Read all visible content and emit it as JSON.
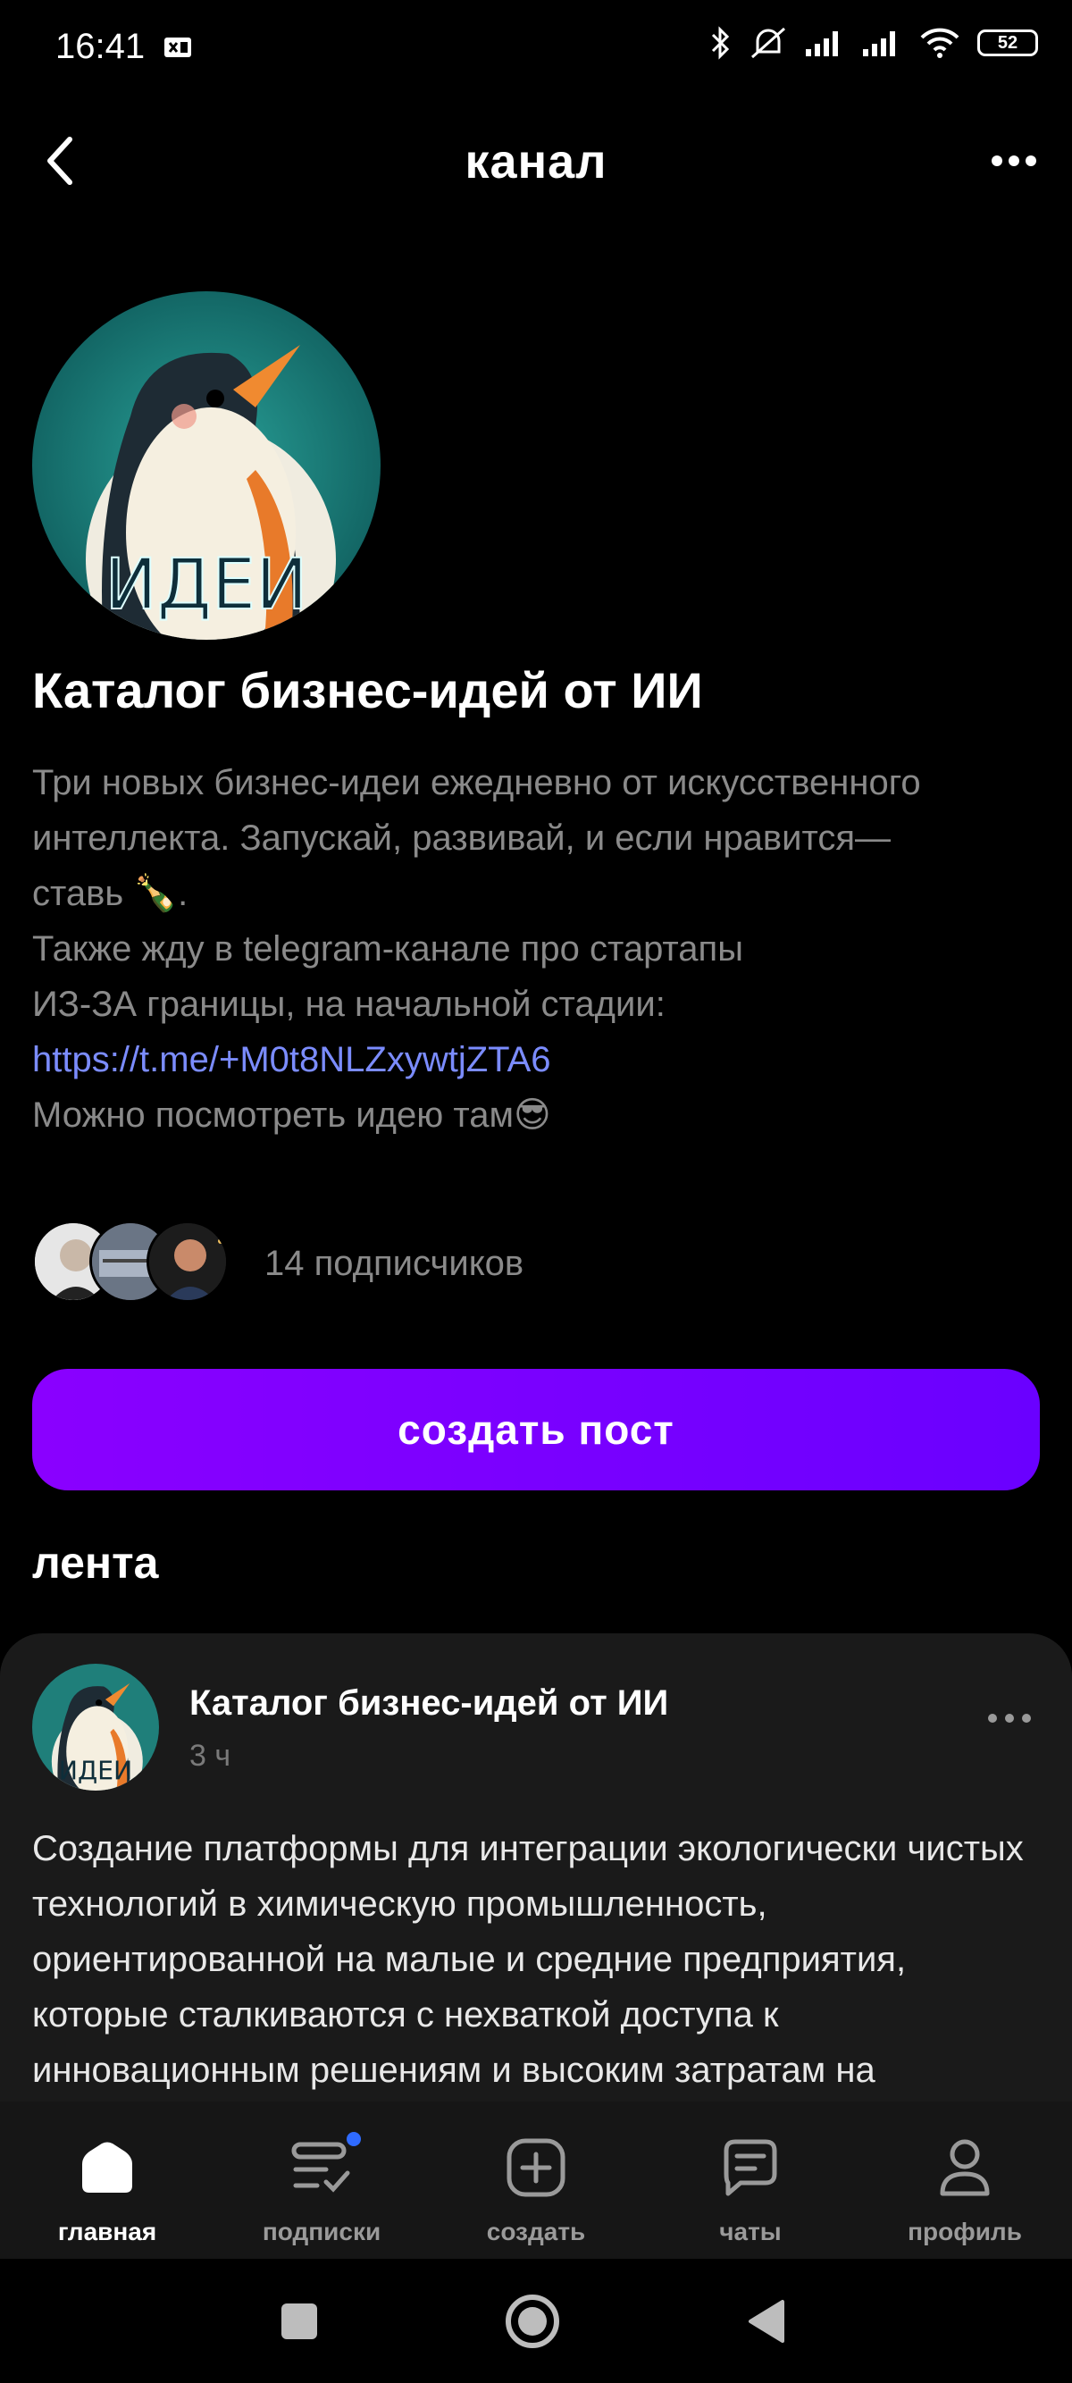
{
  "status_bar": {
    "time": "16:41",
    "battery": "52"
  },
  "header": {
    "title": "канал"
  },
  "channel": {
    "name": "Каталог бизнес-идей от ИИ",
    "avatar_text": "ИДЕИ",
    "description_lines": [
      "Три новых бизнес-идеи ежедневно от искусственного",
      "интеллекта. Запускай, развивай, и если нравится—",
      "ставь 🍾.",
      "Также жду в telegram-канале про стартапы",
      "ИЗ-ЗА границы, на начальной стадии:"
    ],
    "link": "https://t.me/+M0t8NLZxywtjZTA6",
    "description_last": "Можно посмотреть идею там😎",
    "subscribers": "14 подписчиков",
    "create_post_label": "создать пост"
  },
  "feed": {
    "title": "лента",
    "post": {
      "author": "Каталог бизнес-идей от ИИ",
      "time": "3 ч",
      "avatar_text": "ИДЕИ",
      "text": "Создание платформы для интеграции экологически чистых технологий в химическую промышленность, ориентированной на малые и средние предприятия, которые сталкиваются с нехваткой доступа к инновационным решениям и высоким затратам на"
    }
  },
  "bottom_nav": {
    "items": [
      {
        "label": "главная",
        "icon": "home-icon",
        "active": true
      },
      {
        "label": "подписки",
        "icon": "subscriptions-icon",
        "active": false
      },
      {
        "label": "создать",
        "icon": "create-icon",
        "active": false
      },
      {
        "label": "чаты",
        "icon": "chat-icon",
        "active": false
      },
      {
        "label": "профиль",
        "icon": "profile-icon",
        "active": false
      }
    ]
  },
  "colors": {
    "accent": "#7a00ff",
    "link": "#7b8cff",
    "background": "#000000",
    "card": "#1a1a1a"
  }
}
